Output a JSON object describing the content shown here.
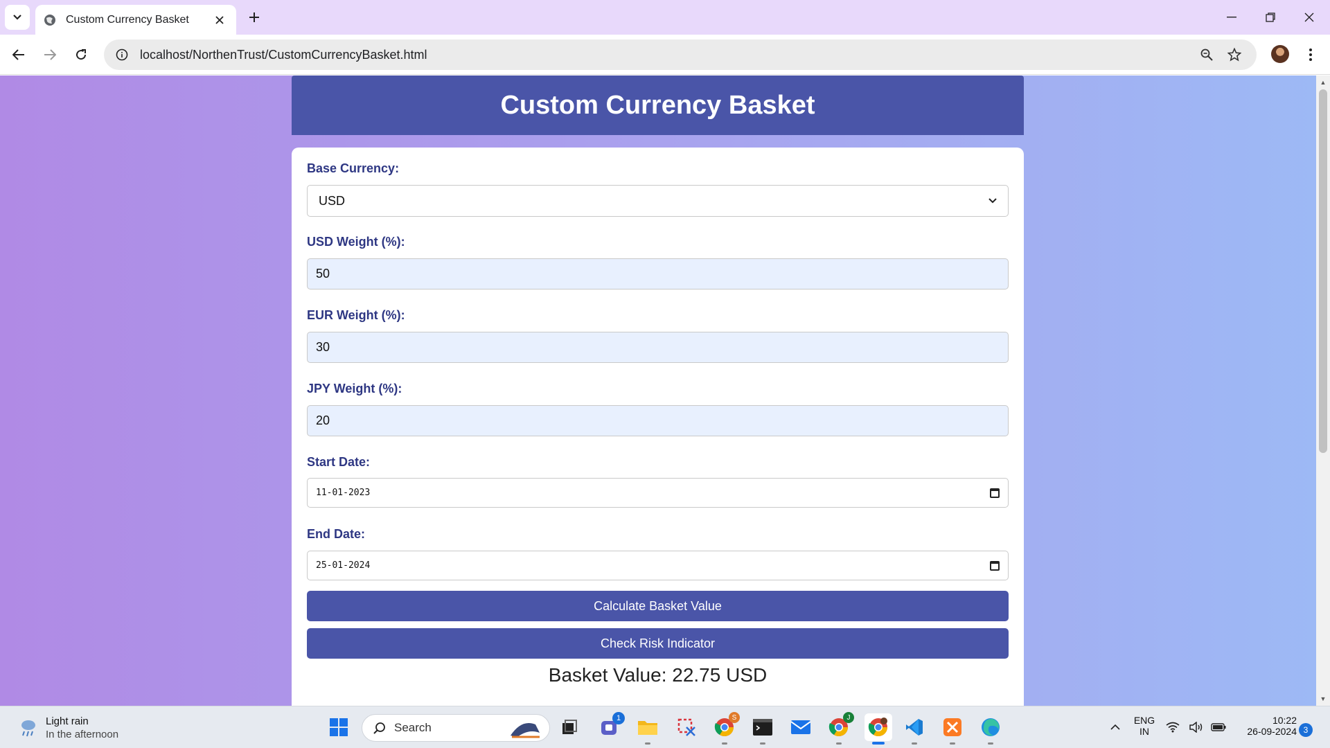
{
  "browser": {
    "tab_title": "Custom Currency Basket",
    "url": "localhost/NorthenTrust/CustomCurrencyBasket.html",
    "icons": [
      "tab-list-icon",
      "globe-icon",
      "close-icon",
      "plus-icon",
      "minimize-icon",
      "restore-icon",
      "window-close-icon",
      "back-arrow-icon",
      "forward-arrow-icon",
      "reload-icon",
      "info-icon",
      "zoom-icon",
      "star-icon",
      "profile-avatar",
      "kebab-menu-icon"
    ]
  },
  "page": {
    "title": "Custom Currency Basket",
    "base_currency": {
      "label": "Base Currency:",
      "selected": "USD"
    },
    "usd_weight": {
      "label": "USD Weight (%):",
      "value": "50"
    },
    "eur_weight": {
      "label": "EUR Weight (%):",
      "value": "30"
    },
    "jpy_weight": {
      "label": "JPY Weight (%):",
      "value": "20"
    },
    "start_date": {
      "label": "Start Date:",
      "value": "11-01-2023"
    },
    "end_date": {
      "label": "End Date:",
      "value": "25-01-2024"
    },
    "calculate_label": "Calculate Basket Value",
    "risk_label": "Check Risk Indicator",
    "basket_value": "Basket Value: 22.75 USD",
    "colors": {
      "header": "#4a55a8",
      "label": "#2e3783",
      "button": "#4a55a8"
    }
  },
  "taskbar": {
    "weather_title": "Light rain",
    "weather_sub": "In the afternoon",
    "search_label": "Search",
    "teams_badge": "1",
    "chrome_badge": "S",
    "chrome2_badge": "J",
    "lang_top": "ENG",
    "lang_bottom": "IN",
    "time": "10:22",
    "date": "26-09-2024",
    "notifications": "3"
  }
}
